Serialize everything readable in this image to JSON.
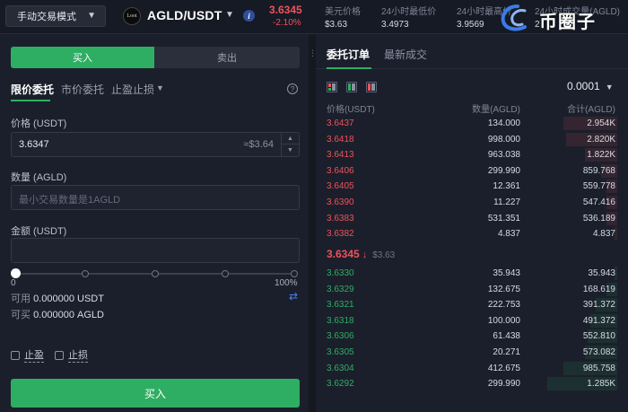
{
  "header": {
    "mode_label": "手动交易模式",
    "coin_logo_text": "Loot",
    "pair": "AGLD/USDT",
    "last_price": "3.6345",
    "change": "-2.10%",
    "stats": [
      {
        "label": "美元价格",
        "value": "$3.63"
      },
      {
        "label": "24小时最低价",
        "value": "3.4973"
      },
      {
        "label": "24小时最高价",
        "value": "3.9569"
      },
      {
        "label": "24小时成交量(AGLD)",
        "value": "2"
      }
    ],
    "watermark": "币圈子"
  },
  "order_form": {
    "tabs": {
      "buy": "买入",
      "sell": "卖出"
    },
    "order_types": [
      "限价委托",
      "市价委托",
      "止盈止损"
    ],
    "price_label": "价格 (USDT)",
    "price_value": "3.6347",
    "price_hint": "≈$3.64",
    "amount_label": "数量 (AGLD)",
    "amount_placeholder": "最小交易数量是1AGLD",
    "total_label": "金额 (USDT)",
    "slider_min": "0",
    "slider_max": "100%",
    "slider_value": 0,
    "available_label": "可用",
    "available_value": "0.000000 USDT",
    "buyable_label": "可买",
    "buyable_value": "0.000000 AGLD",
    "take_profit": "止盈",
    "stop_loss": "止损",
    "submit": "买入"
  },
  "orderbook": {
    "tabs": [
      "委托订单",
      "最新成交"
    ],
    "precision": "0.0001",
    "columns": {
      "price": "价格(USDT)",
      "amount": "数量(AGLD)",
      "total": "合计(AGLD)"
    },
    "asks": [
      {
        "price": "3.6437",
        "amount": "134.000",
        "total": "2.954K",
        "depth": 0.2
      },
      {
        "price": "3.6418",
        "amount": "998.000",
        "total": "2.820K",
        "depth": 0.19
      },
      {
        "price": "3.6413",
        "amount": "963.038",
        "total": "1.822K",
        "depth": 0.12
      },
      {
        "price": "3.6406",
        "amount": "299.990",
        "total": "859.768",
        "depth": 0.06
      },
      {
        "price": "3.6405",
        "amount": "12.361",
        "total": "559.778",
        "depth": 0.04
      },
      {
        "price": "3.6390",
        "amount": "11.227",
        "total": "547.416",
        "depth": 0.04
      },
      {
        "price": "3.6383",
        "amount": "531.351",
        "total": "536.189",
        "depth": 0.04
      },
      {
        "price": "3.6382",
        "amount": "4.837",
        "total": "4.837",
        "depth": 0.01
      }
    ],
    "mid_price": "3.6345",
    "mid_arrow": "↓",
    "mid_fiat": "$3.63",
    "bids": [
      {
        "price": "3.6330",
        "amount": "35.943",
        "total": "35.943",
        "depth": 0.01
      },
      {
        "price": "3.6329",
        "amount": "132.675",
        "total": "168.619",
        "depth": 0.04
      },
      {
        "price": "3.6321",
        "amount": "222.753",
        "total": "391.372",
        "depth": 0.08
      },
      {
        "price": "3.6318",
        "amount": "100.000",
        "total": "491.372",
        "depth": 0.1
      },
      {
        "price": "3.6306",
        "amount": "61.438",
        "total": "552.810",
        "depth": 0.11
      },
      {
        "price": "3.6305",
        "amount": "20.271",
        "total": "573.082",
        "depth": 0.12
      },
      {
        "price": "3.6304",
        "amount": "412.675",
        "total": "985.758",
        "depth": 0.2
      },
      {
        "price": "3.6292",
        "amount": "299.990",
        "total": "1.285K",
        "depth": 0.26
      }
    ]
  },
  "colors": {
    "buy_green": "#2eae63",
    "sell_red": "#f0515a",
    "background": "#1b1f2b",
    "link_blue": "#4c7cf3"
  },
  "icons": {
    "mode_dropdown": "chevron-down-icon",
    "info": "info-icon",
    "help": "question-circle-icon",
    "transfer": "transfer-arrows-icon",
    "layouts": [
      "layout-both-icon",
      "layout-bids-icon",
      "layout-asks-icon"
    ]
  }
}
